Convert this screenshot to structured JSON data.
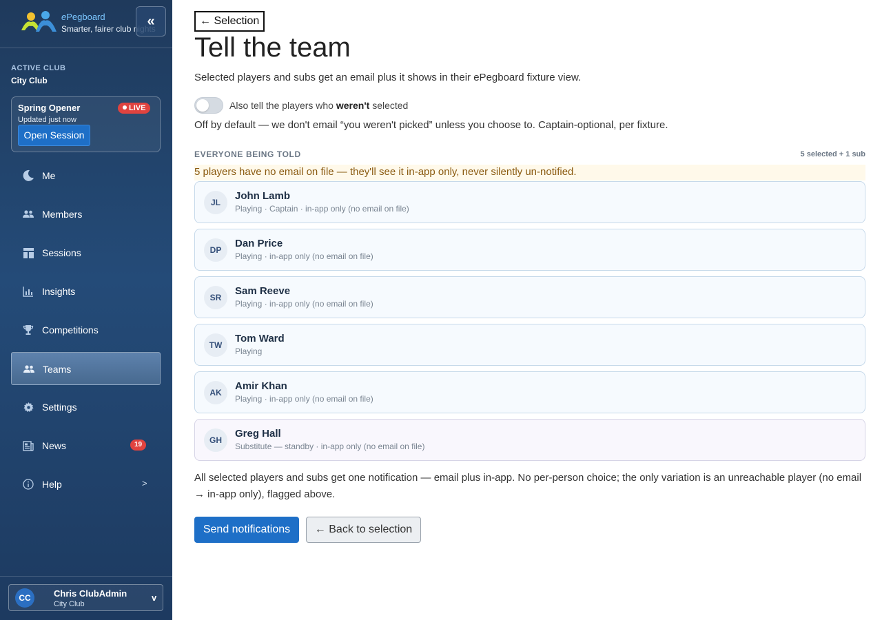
{
  "brand": {
    "name_prefix": "e",
    "name_rest": "Pegboard",
    "tagline": "Smarter, fairer club nights",
    "collapse_label": "«",
    "logo_icon": "two-figures-logo"
  },
  "club": {
    "label": "ACTIVE CLUB",
    "name": "City Club"
  },
  "session": {
    "title": "Spring Opener",
    "updated": "Updated just now",
    "live_label": "LIVE",
    "open_label": "Open Session"
  },
  "nav": {
    "items": [
      {
        "label": "Me",
        "icon": "moon-icon"
      },
      {
        "label": "Members",
        "icon": "people-icon"
      },
      {
        "label": "Sessions",
        "icon": "dashboard-icon"
      },
      {
        "label": "Insights",
        "icon": "bar-chart-icon"
      },
      {
        "label": "Competitions",
        "icon": "trophy-icon"
      },
      {
        "label": "Teams",
        "icon": "people-icon",
        "active": true
      },
      {
        "label": "Settings",
        "icon": "gear-icon"
      },
      {
        "label": "News",
        "icon": "newspaper-icon",
        "badge": "19"
      },
      {
        "label": "Help",
        "icon": "info-icon",
        "chevron": ">"
      }
    ]
  },
  "user": {
    "initials": "CC",
    "name": "Chris ClubAdmin",
    "club": "City Club",
    "caret": "v"
  },
  "main": {
    "back_link": "← Selection",
    "title": "Tell the team",
    "intro": "Selected players and subs get an email plus it shows in their ePegboard fixture view.",
    "toggle_before": "Also tell the players who ",
    "toggle_bold": "weren't",
    "toggle_after": " selected",
    "toggle_on": false,
    "toggle_note": "Off by default — we don't email “you weren't picked” unless you choose to. Captain-optional, per fixture.",
    "section_heading": "EVERYONE BEING TOLD",
    "section_count": "5 selected + 1 sub",
    "warning": "5 players have no email on file — they'll see it in-app only, never silently un-notified.",
    "players": [
      {
        "initials": "JL",
        "name": "John Lamb",
        "meta": "Playing · Captain · in-app only (no email on file)",
        "sub": false
      },
      {
        "initials": "DP",
        "name": "Dan Price",
        "meta": "Playing · in-app only (no email on file)",
        "sub": false
      },
      {
        "initials": "SR",
        "name": "Sam Reeve",
        "meta": "Playing · in-app only (no email on file)",
        "sub": false
      },
      {
        "initials": "TW",
        "name": "Tom Ward",
        "meta": "Playing",
        "sub": false
      },
      {
        "initials": "AK",
        "name": "Amir Khan",
        "meta": "Playing · in-app only (no email on file)",
        "sub": false
      },
      {
        "initials": "GH",
        "name": "Greg Hall",
        "meta": "Substitute — standby · in-app only (no email on file)",
        "sub": true
      }
    ],
    "summary": "All selected players and subs get one notification — email plus in-app. No per-person choice; the only variation is an unreachable player (no email → in-app only), flagged above.",
    "send_label": "Send notifications",
    "back_label": "← Back to selection"
  },
  "colors": {
    "sidebar": "#244b78",
    "primary": "#1e6fc7",
    "live": "#e0433f",
    "warning_bg": "#fff9ea"
  }
}
